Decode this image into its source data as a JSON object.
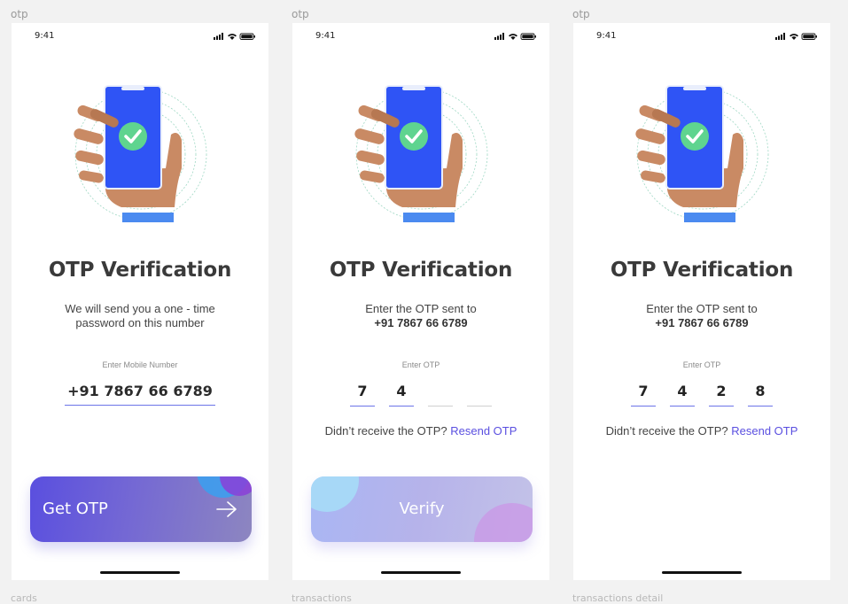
{
  "frames": [
    {
      "frame_label": "otp",
      "status_time": "9:41",
      "title": "OTP Verification",
      "subtitle_line1": "We will send you a one - time",
      "subtitle_line2": "password on this number",
      "field_label": "Enter Mobile Number",
      "mobile_number": "+91 7867 66 6789",
      "button_label": "Get OTP",
      "button_icon": "arrow-right-icon"
    },
    {
      "frame_label": "otp",
      "status_time": "9:41",
      "title": "OTP Verification",
      "subtitle_line1": "Enter the OTP sent to",
      "phone_number": "+91 7867 66 6789",
      "field_label": "Enter OTP",
      "otp_digits": [
        "7",
        "4",
        "",
        ""
      ],
      "resend_prompt": "Didn’t receive the OTP?",
      "resend_link": "Resend OTP",
      "button_label": "Verify"
    },
    {
      "frame_label": "otp",
      "status_time": "9:41",
      "title": "OTP Verification",
      "subtitle_line1": "Enter the OTP sent to",
      "phone_number": "+91 7867 66 6789",
      "field_label": "Enter OTP",
      "otp_digits": [
        "7",
        "4",
        "2",
        "8"
      ],
      "resend_prompt": "Didn’t receive the OTP?",
      "resend_link": "Resend OTP"
    }
  ],
  "bottom_labels": [
    "cards",
    "transactions",
    "transactions detail"
  ],
  "colors": {
    "accent": "#5a4fe0",
    "phone_screen": "#2f54f5",
    "check": "#5fd48f",
    "skin": "#c98a64",
    "sleeve": "#4b8af0"
  }
}
